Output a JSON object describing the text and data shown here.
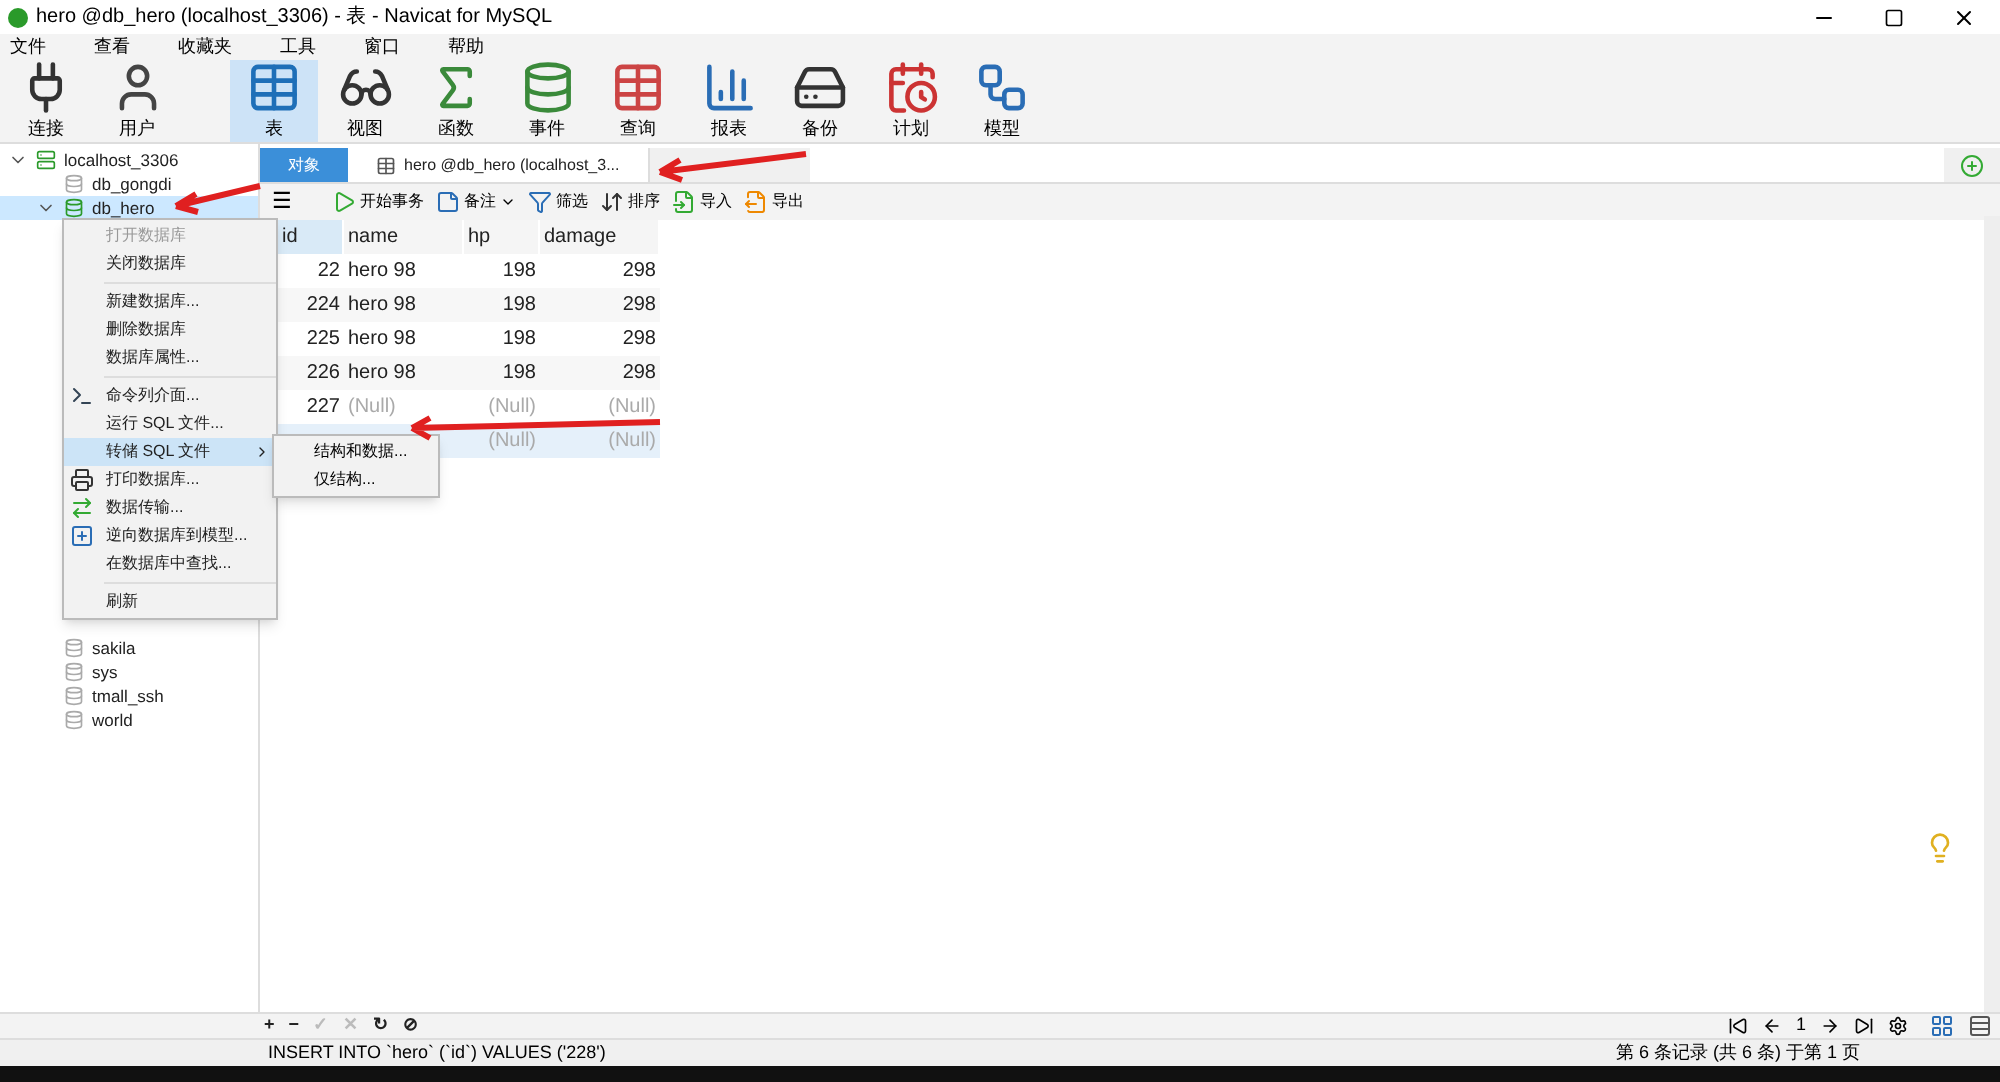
{
  "window": {
    "title": "hero @db_hero (localhost_3306) - 表 - Navicat for MySQL"
  },
  "menu_bar": [
    "文件",
    "查看",
    "收藏夹",
    "工具",
    "窗口",
    "帮助"
  ],
  "toolbar": [
    {
      "kind": "connect",
      "label": "连接",
      "selected": false
    },
    {
      "kind": "user",
      "label": "用户",
      "selected": false
    },
    {
      "kind": "table",
      "label": "表",
      "selected": true
    },
    {
      "kind": "view",
      "label": "视图",
      "selected": false
    },
    {
      "kind": "function",
      "label": "函数",
      "selected": false
    },
    {
      "kind": "event",
      "label": "事件",
      "selected": false
    },
    {
      "kind": "query",
      "label": "查询",
      "selected": false
    },
    {
      "kind": "report",
      "label": "报表",
      "selected": false
    },
    {
      "kind": "backup",
      "label": "备份",
      "selected": false
    },
    {
      "kind": "schedule",
      "label": "计划",
      "selected": false
    },
    {
      "kind": "model",
      "label": "模型",
      "selected": false
    }
  ],
  "tree": [
    {
      "label": "localhost_3306",
      "kind": "server",
      "open": true,
      "expanded": true,
      "selected": false,
      "children": [
        {
          "label": "db_gongdi",
          "kind": "db",
          "open": false,
          "selected": false
        },
        {
          "label": "db_hero",
          "kind": "db",
          "open": true,
          "expanded": true,
          "selected": true
        },
        {
          "label": "sakila",
          "kind": "db",
          "open": false,
          "selected": false
        },
        {
          "label": "sys",
          "kind": "db",
          "open": false,
          "selected": false
        },
        {
          "label": "tmall_ssh",
          "kind": "db",
          "open": false,
          "selected": false
        },
        {
          "label": "world",
          "kind": "db",
          "open": false,
          "selected": false
        }
      ]
    }
  ],
  "tabs": [
    {
      "label": "对象",
      "kind": "objects",
      "selected": true
    },
    {
      "label": "hero @db_hero (localhost_3...",
      "kind": "table",
      "selected": false
    }
  ],
  "table_toolbar": [
    {
      "kind": "menu",
      "label": "☰"
    },
    {
      "kind": "transaction",
      "label": "开始事务"
    },
    {
      "kind": "memo",
      "label": "备注"
    },
    {
      "kind": "filter",
      "label": "筛选"
    },
    {
      "kind": "sort",
      "label": "排序"
    },
    {
      "kind": "import",
      "label": "导入"
    },
    {
      "kind": "export",
      "label": "导出"
    }
  ],
  "table": {
    "columns": [
      "id",
      "name",
      "hp",
      "damage"
    ],
    "rows": [
      {
        "selected": false,
        "cells": [
          "22",
          "hero 98",
          "198",
          "298"
        ]
      },
      {
        "selected": false,
        "cells": [
          "224",
          "hero 98",
          "198",
          "298"
        ]
      },
      {
        "selected": false,
        "cells": [
          "225",
          "hero 98",
          "198",
          "298"
        ]
      },
      {
        "selected": false,
        "cells": [
          "226",
          "hero 98",
          "198",
          "298"
        ]
      },
      {
        "selected": false,
        "cells": [
          "227",
          "(Null)",
          "(Null)",
          "(Null)"
        ]
      },
      {
        "selected": true,
        "cells": [
          null,
          null,
          "(Null)",
          "(Null)"
        ]
      }
    ]
  },
  "context_menu": {
    "items": [
      {
        "kind": "item",
        "label": "打开数据库",
        "disabled": true,
        "selected": false
      },
      {
        "kind": "item",
        "label": "关闭数据库",
        "disabled": false,
        "selected": false
      },
      {
        "kind": "separator"
      },
      {
        "kind": "item",
        "label": "新建数据库...",
        "disabled": false,
        "selected": false
      },
      {
        "kind": "item",
        "label": "删除数据库",
        "disabled": false,
        "selected": false
      },
      {
        "kind": "item",
        "label": "数据库属性...",
        "disabled": false,
        "selected": false
      },
      {
        "kind": "separator"
      },
      {
        "kind": "console",
        "label": "命令列介面...",
        "disabled": false,
        "selected": false
      },
      {
        "kind": "item",
        "label": "运行 SQL 文件...",
        "disabled": false,
        "selected": false
      },
      {
        "kind": "submenu",
        "label": "转储 SQL 文件",
        "disabled": false,
        "selected": true
      },
      {
        "kind": "print",
        "label": "打印数据库...",
        "disabled": false,
        "selected": false
      },
      {
        "kind": "transfer",
        "label": "数据传输...",
        "disabled": false,
        "selected": false
      },
      {
        "kind": "model",
        "label": "逆向数据库到模型...",
        "disabled": false,
        "selected": false
      },
      {
        "kind": "item",
        "label": "在数据库中查找...",
        "disabled": false,
        "selected": false
      },
      {
        "kind": "separator"
      },
      {
        "kind": "item",
        "label": "刷新",
        "disabled": false,
        "selected": false
      }
    ],
    "submenu": [
      "结构和数据...",
      "仅结构..."
    ]
  },
  "bottom_toolbar": [
    {
      "label": "+",
      "disabled": false
    },
    {
      "label": "−",
      "disabled": false
    },
    {
      "label": "✓",
      "disabled": true
    },
    {
      "label": "✕",
      "disabled": true
    },
    {
      "label": "↻",
      "disabled": false
    },
    {
      "label": "⊘",
      "disabled": false
    }
  ],
  "pager": {
    "page": "1"
  },
  "status_bar": {
    "sql": "INSERT INTO `hero` (`id`) VALUES ('228')",
    "records": "第 6 条记录 (共 6 条) 于第 1 页"
  }
}
